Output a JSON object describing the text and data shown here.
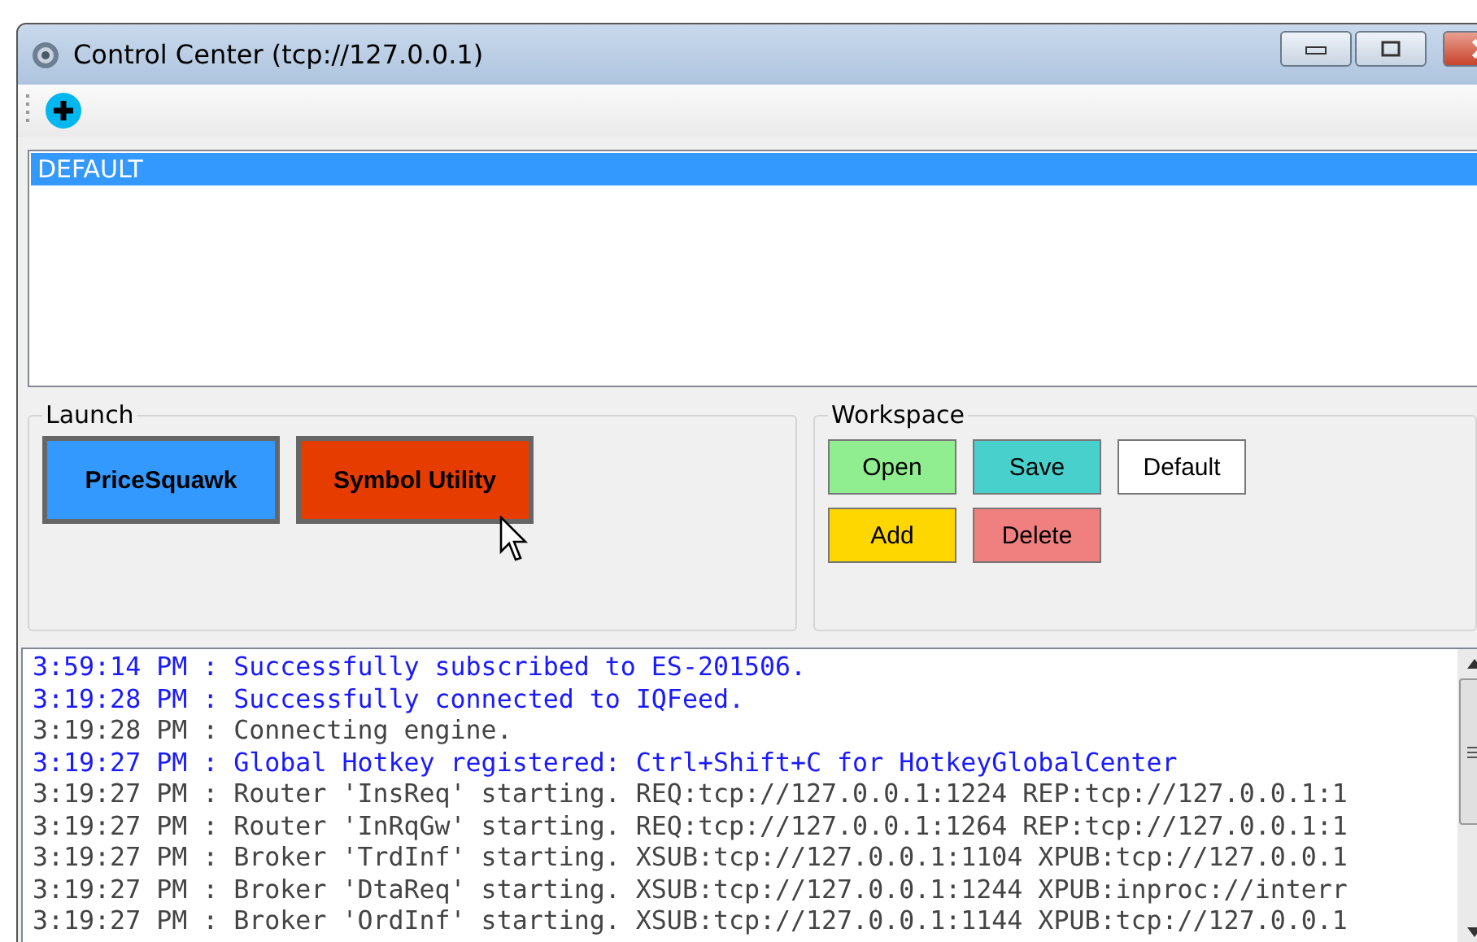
{
  "window": {
    "title": "Control Center (tcp://127.0.0.1)"
  },
  "workspaces": {
    "items": [
      {
        "label": "DEFAULT",
        "selected": true
      }
    ]
  },
  "launch": {
    "title": "Launch",
    "buttons": [
      {
        "label": "PriceSquawk",
        "color": "#3399ff"
      },
      {
        "label": "Symbol Utility",
        "color": "#e63c00"
      }
    ]
  },
  "workspace": {
    "title": "Workspace",
    "buttons": [
      {
        "label": "Open",
        "color": "#90ee90"
      },
      {
        "label": "Save",
        "color": "#48d1cc"
      },
      {
        "label": "Default",
        "color": "#ffffff"
      },
      {
        "label": "Add",
        "color": "#ffd700"
      },
      {
        "label": "Delete",
        "color": "#f08080"
      }
    ]
  },
  "log": [
    {
      "text": "3:59:14 PM : Successfully subscribed to ES-201506.",
      "kind": "notice"
    },
    {
      "text": "3:19:28 PM : Successfully connected to IQFeed.",
      "kind": "notice"
    },
    {
      "text": "3:19:28 PM : Connecting engine.",
      "kind": "plain"
    },
    {
      "text": "3:19:27 PM : Global Hotkey registered: Ctrl+Shift+C for HotkeyGlobalCenter",
      "kind": "notice"
    },
    {
      "text": "3:19:27 PM : Router 'InsReq' starting. REQ:tcp://127.0.0.1:1224 REP:tcp://127.0.0.1:1",
      "kind": "plain"
    },
    {
      "text": "3:19:27 PM : Router 'InRqGw' starting. REQ:tcp://127.0.0.1:1264 REP:tcp://127.0.0.1:1",
      "kind": "plain"
    },
    {
      "text": "3:19:27 PM : Broker 'TrdInf' starting. XSUB:tcp://127.0.0.1:1104 XPUB:tcp://127.0.0.1",
      "kind": "plain"
    },
    {
      "text": "3:19:27 PM : Broker 'DtaReq' starting. XSUB:tcp://127.0.0.1:1244 XPUB:inproc://interr",
      "kind": "plain"
    },
    {
      "text": "3:19:27 PM : Broker 'OrdInf' starting. XSUB:tcp://127.0.0.1:1144 XPUB:tcp://127.0.0.1",
      "kind": "plain"
    }
  ]
}
